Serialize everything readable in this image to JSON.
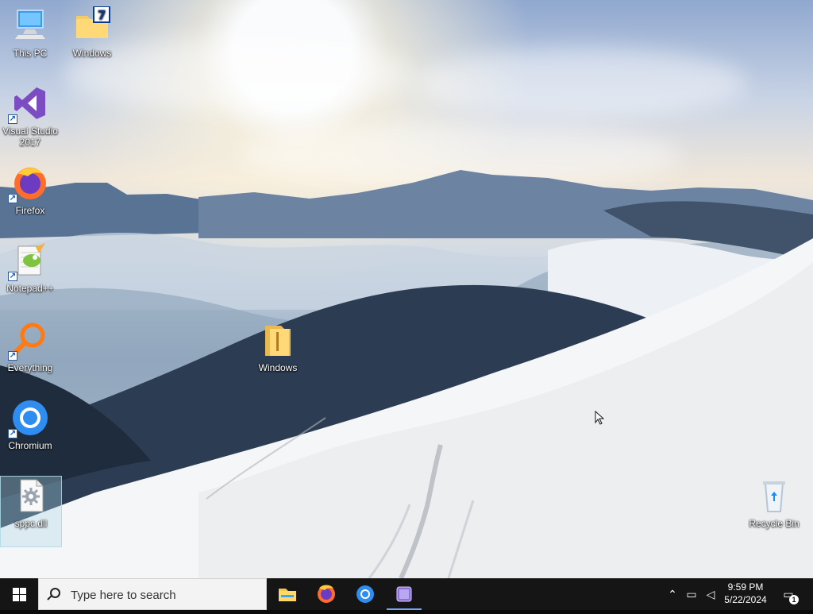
{
  "desktop": {
    "icons": [
      {
        "label": "This PC",
        "icon": "computer-icon"
      },
      {
        "label": "Windows",
        "icon": "folder-icon"
      },
      {
        "label": "Visual Studio\n2017",
        "icon": "visual-studio-icon"
      },
      {
        "label": "Firefox",
        "icon": "firefox-icon"
      },
      {
        "label": "Notepad++",
        "icon": "notepad-plus-plus-icon"
      },
      {
        "label": "Everything",
        "icon": "everything-search-icon"
      },
      {
        "label": "Chromium",
        "icon": "chromium-icon"
      },
      {
        "label": "sppc.dll",
        "icon": "dll-file-icon"
      },
      {
        "label": "Windows",
        "icon": "folder-icon"
      },
      {
        "label": "Recycle Bin",
        "icon": "recycle-bin-icon"
      }
    ]
  },
  "taskbar": {
    "search_placeholder": "Type here to search",
    "apps": [
      {
        "name": "File Explorer",
        "icon": "file-explorer-icon"
      },
      {
        "name": "Firefox",
        "icon": "firefox-icon"
      },
      {
        "name": "Chromium",
        "icon": "chromium-icon"
      },
      {
        "name": "Visual Studio",
        "icon": "visual-studio-icon",
        "active": true
      }
    ],
    "clock_time": "9:59 PM",
    "clock_date": "5/22/2024",
    "notification_count": "1"
  },
  "colors": {
    "taskbar_bg": "#151515",
    "search_bg": "#f3f3f3",
    "active_indicator": "#77a7ff"
  }
}
